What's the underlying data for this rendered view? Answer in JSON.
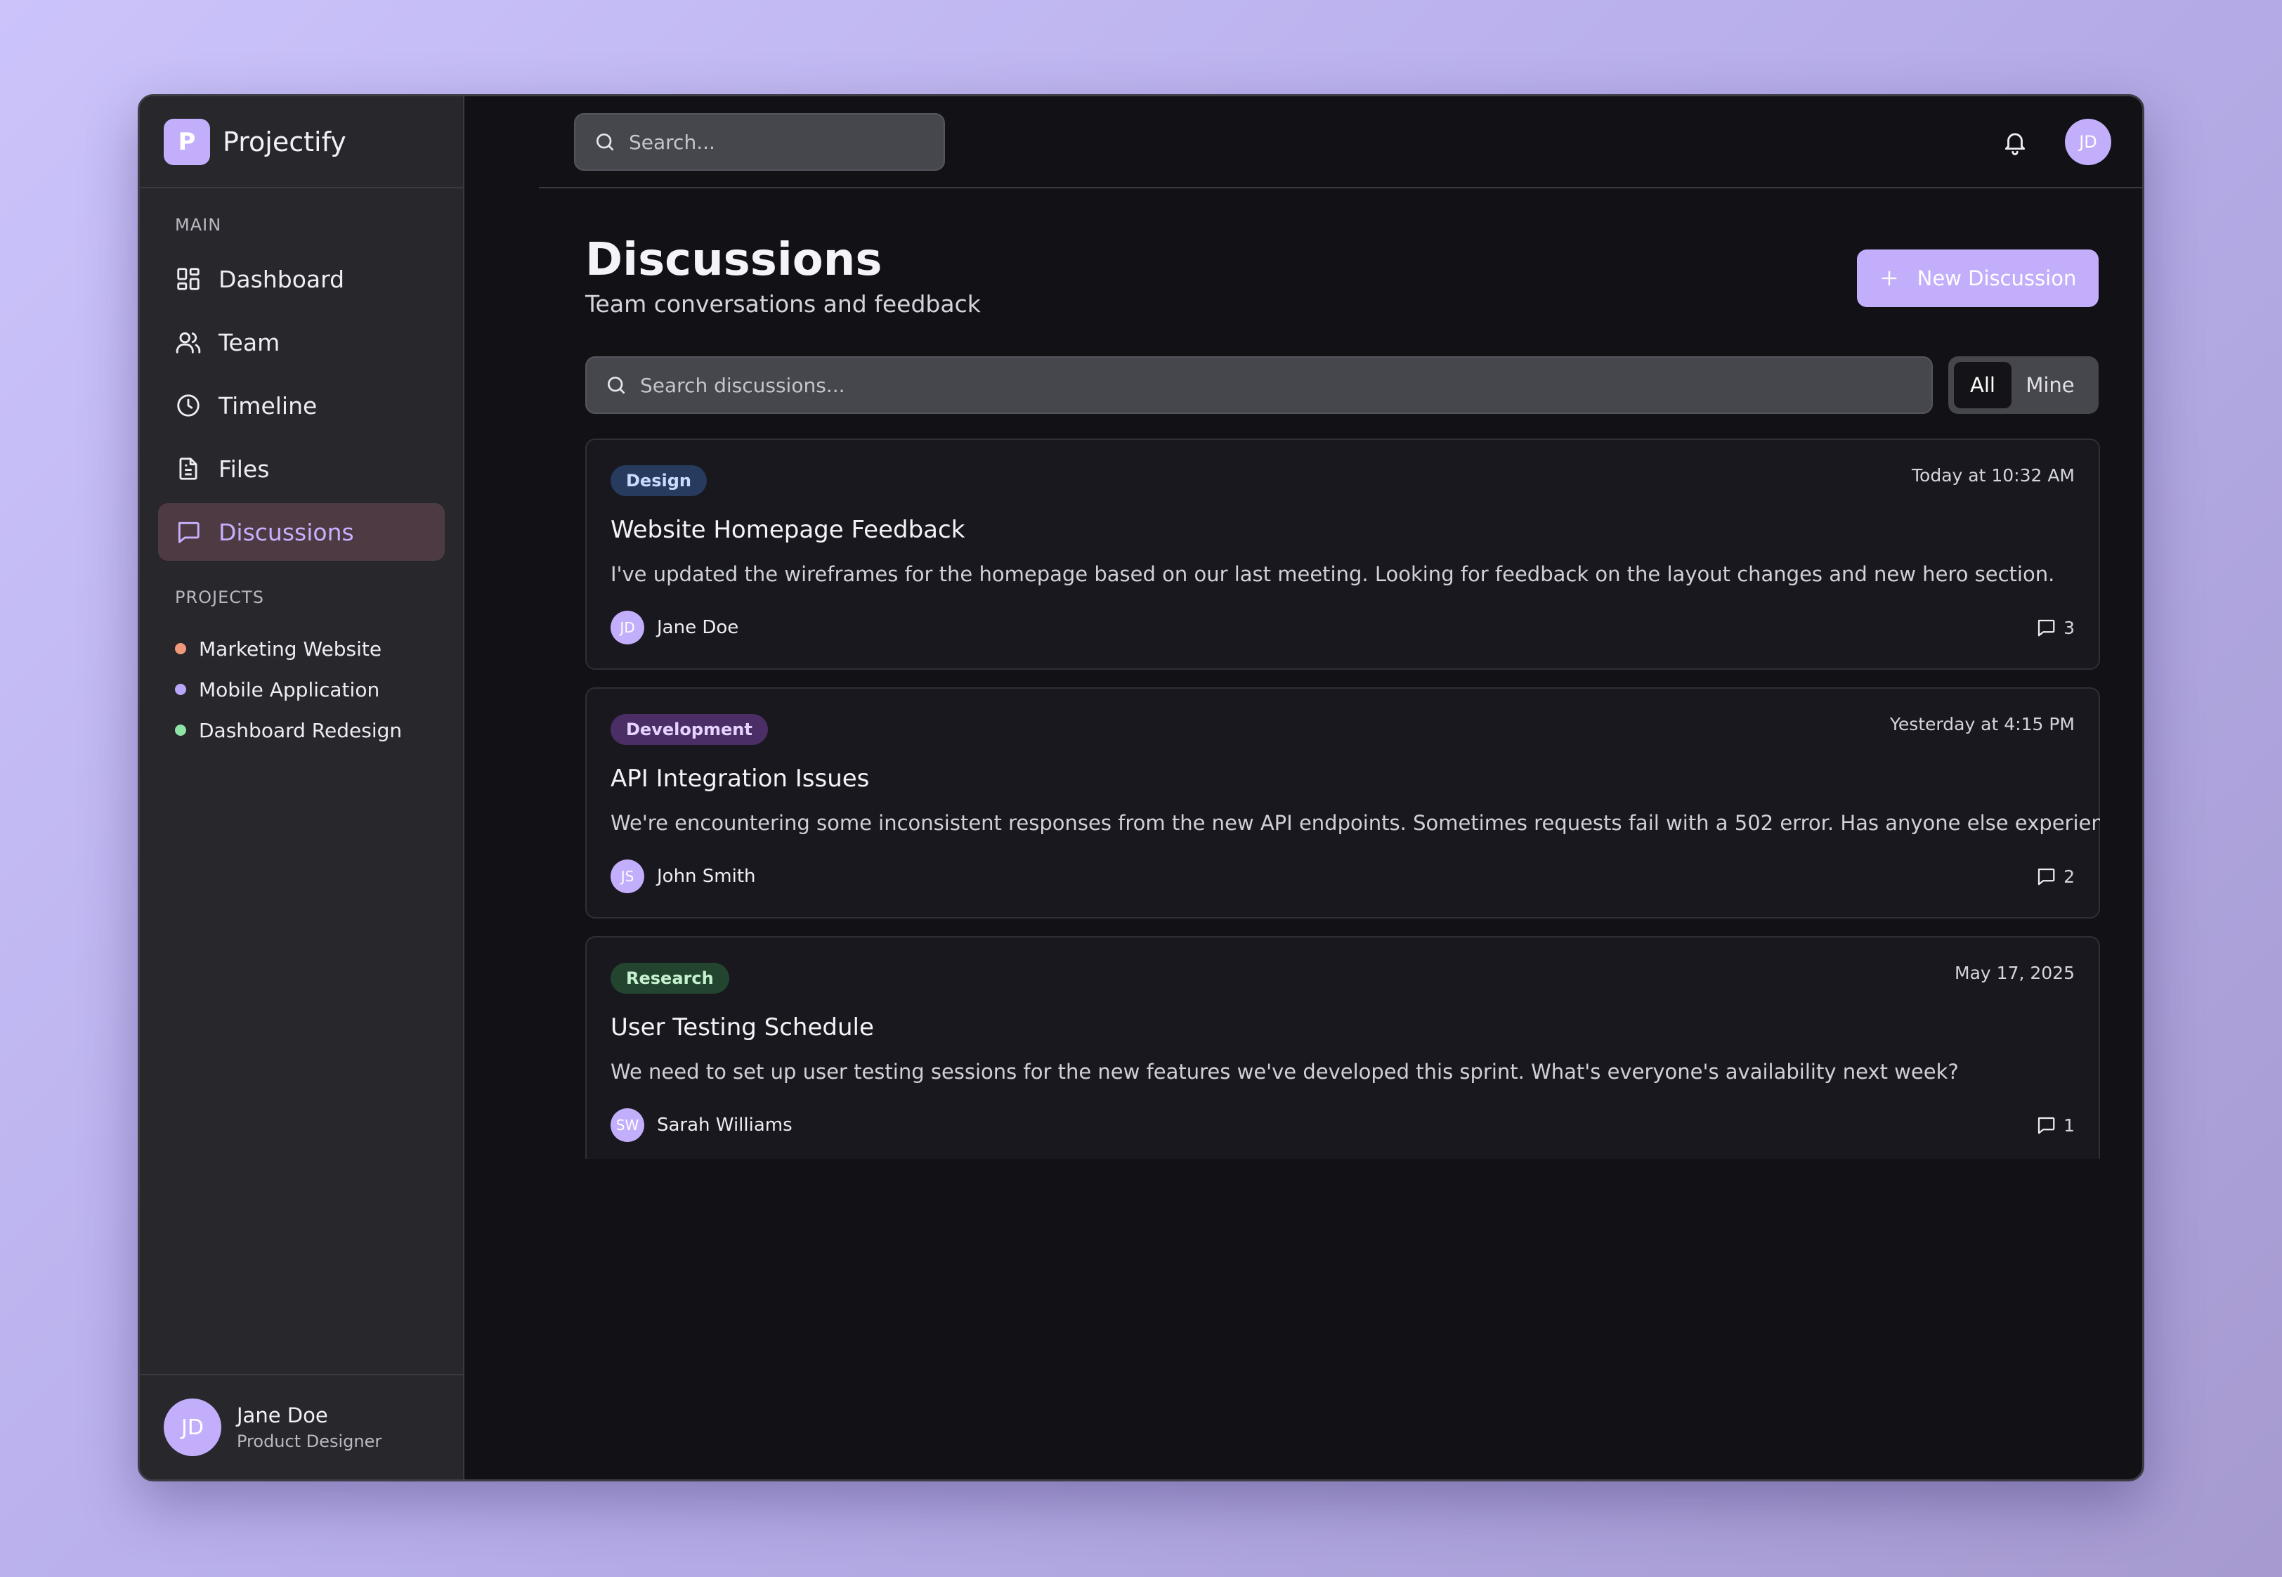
{
  "brand": {
    "logo_letter": "P",
    "name": "Projectify"
  },
  "sidebar": {
    "main_label": "MAIN",
    "items": [
      {
        "label": "Dashboard",
        "icon": "dashboard-icon"
      },
      {
        "label": "Team",
        "icon": "users-icon"
      },
      {
        "label": "Timeline",
        "icon": "clock-icon"
      },
      {
        "label": "Files",
        "icon": "file-icon"
      },
      {
        "label": "Discussions",
        "icon": "message-icon",
        "active": true
      }
    ],
    "projects_label": "PROJECTS",
    "projects": [
      {
        "name": "Marketing Website",
        "color": "#f0987a"
      },
      {
        "name": "Mobile Application",
        "color": "#b9a6fb"
      },
      {
        "name": "Dashboard Redesign",
        "color": "#8ee3a6"
      }
    ],
    "user": {
      "initials": "JD",
      "name": "Jane Doe",
      "role": "Product Designer"
    }
  },
  "topbar": {
    "search_placeholder": "Search...",
    "avatar_initials": "JD"
  },
  "page": {
    "title": "Discussions",
    "subtitle": "Team conversations and feedback",
    "new_button": "New Discussion",
    "search_placeholder": "Search discussions...",
    "filters": {
      "all": "All",
      "mine": "Mine"
    }
  },
  "discussions": [
    {
      "tag": "Design",
      "date": "Today at 10:32 AM",
      "title": "Website Homepage Feedback",
      "body": "I've updated the wireframes for the homepage based on our last meeting. Looking for feedback on the layout changes and new hero section.",
      "author_initials": "JD",
      "author": "Jane Doe",
      "comments": "3"
    },
    {
      "tag": "Development",
      "date": "Yesterday at 4:15 PM",
      "title": "API Integration Issues",
      "body": "We're encountering some inconsistent responses from the new API endpoints. Sometimes requests fail with a 502 error. Has anyone else experienced this?",
      "author_initials": "JS",
      "author": "John Smith",
      "comments": "2"
    },
    {
      "tag": "Research",
      "date": "May 17, 2025",
      "title": "User Testing Schedule",
      "body": "We need to set up user testing sessions for the new features we've developed this sprint. What's everyone's availability next week?",
      "author_initials": "SW",
      "author": "Sarah Williams",
      "comments": "1"
    }
  ],
  "colors": {
    "accent": "#c3aefb",
    "active_nav_bg": "#4e3a42",
    "active_nav_text": "#c7b1ff",
    "app_bg": "#111116",
    "sidebar_bg": "#27272c"
  }
}
